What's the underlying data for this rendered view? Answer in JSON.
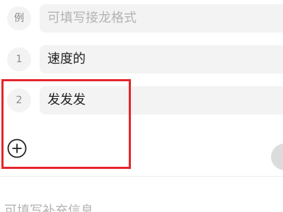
{
  "relay_items": [
    {
      "index_label": "例",
      "text": "",
      "placeholder": "可填写接龙格式"
    },
    {
      "index_label": "1",
      "text": "速度的",
      "placeholder": ""
    },
    {
      "index_label": "2",
      "text": "发发发",
      "placeholder": ""
    }
  ],
  "add_button": {
    "icon": "plus-circle-icon"
  },
  "extra_info": {
    "placeholder": "可填写补充信息"
  },
  "colors": {
    "field_bg": "#f3f3f3",
    "highlight": "#e6242b",
    "placeholder_text": "#b3b3b3"
  }
}
